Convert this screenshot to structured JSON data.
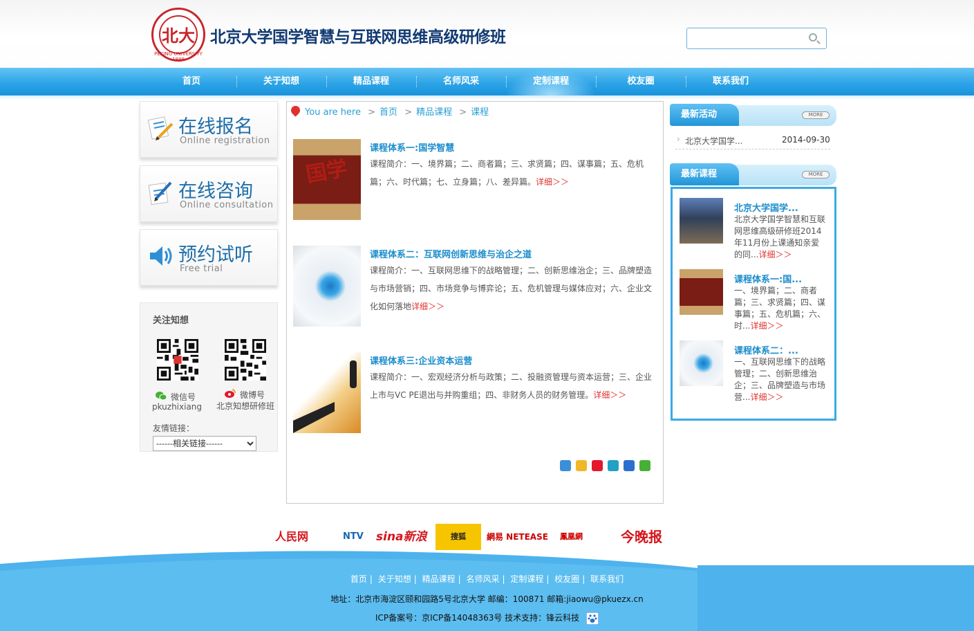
{
  "header": {
    "logo_text": "PEKING UNIVERSITY 1898",
    "title": "北京大学国学智慧与互联网思维高级研修班",
    "search_placeholder": ""
  },
  "nav": [
    "首页",
    "关于知想",
    "精品课程",
    "名师风采",
    "定制课程",
    "校友圈",
    "联系我们"
  ],
  "side_buttons": [
    {
      "title": "在线报名",
      "sub": "Online registration",
      "icon": "registration-icon"
    },
    {
      "title": "在线咨询",
      "sub": "Online consultation",
      "icon": "consultation-icon"
    },
    {
      "title": "预约试听",
      "sub": "Free trial",
      "icon": "speaker-icon"
    }
  ],
  "follow": {
    "title": "关注知想",
    "wechat_label": "微信号",
    "wechat_id": "pkuzhixiang",
    "weibo_label": "微博号",
    "weibo_id": "北京知想研修班",
    "links_label": "友情链接：",
    "links_select": "------相关链接------"
  },
  "breadcrumb": {
    "you_are_here": "You are here",
    "items": [
      "首页",
      "精品课程",
      "课程"
    ]
  },
  "courses": [
    {
      "title": "课程体系一:国学智慧",
      "desc": "课程简介：一、境界篇；二、商者篇；三、求贤篇；四、谋事篇；五、危机篇；六、时代篇；七、立身篇；八、差异篇。",
      "more": "详细＞＞"
    },
    {
      "title": "课程体系二：互联网创新思维与治企之道",
      "desc": "课程简介：一、互联网思维下的战略管理；二、创新思维治企；三、品牌塑造与市场营销；四、市场竞争与博弈论；五、危机管理与媒体应对；六、企业文化如何落地",
      "more": "详细＞＞"
    },
    {
      "title": "课程体系三:企业资本运营",
      "desc": "课程简介：一、宏观经济分析与政策；二、投融资管理与资本运营；三、企业上市与VC PE退出与并购重组；四、非财务人员的财务管理。",
      "more": "详细＞＞"
    }
  ],
  "right": {
    "activities_title": "最新活动",
    "more": "MORE",
    "activity": {
      "title": "北京大学国学...",
      "date": "2014-09-30"
    },
    "courses_title": "最新课程",
    "course_items": [
      {
        "title": "北京大学国学...",
        "desc": "北京大学国学智慧和互联网思维高级研修班2014年11月份上课通知亲爱的同...",
        "more": "详细＞＞"
      },
      {
        "title": "课程体系一:国...",
        "desc": "一、境界篇；二、商者篇；三、求贤篇；四、谋事篇；五、危机篇；六、时...",
        "more": "详细＞＞"
      },
      {
        "title": "课程体系二：...",
        "desc": "一、互联网思维下的战略管理；二、创新思维治企；三、品牌塑造与市场营...",
        "more": "详细＞＞"
      }
    ]
  },
  "partners": [
    "人民网",
    "NTV",
    "sina新浪",
    "搜狐 SOHU.com",
    "網易 NETEASE",
    "鳳凰網 ifeng.com",
    "今晚报"
  ],
  "footer": {
    "nav": [
      "首页",
      "关于知想",
      "精品课程",
      "名师风采",
      "定制课程",
      "校友圈",
      "联系我们"
    ],
    "address": "地址：北京市海淀区颐和园路5号北京大学   邮编：100871   邮箱:jiaowu@pkuezx.cn",
    "icp": "ICP备案号：京ICP备14048363号    技术支持：锋云科技"
  },
  "colors": {
    "accent": "#2aa2e6",
    "title_blue": "#123a73",
    "link_blue": "#1a8ccc",
    "red": "#e0312f"
  }
}
